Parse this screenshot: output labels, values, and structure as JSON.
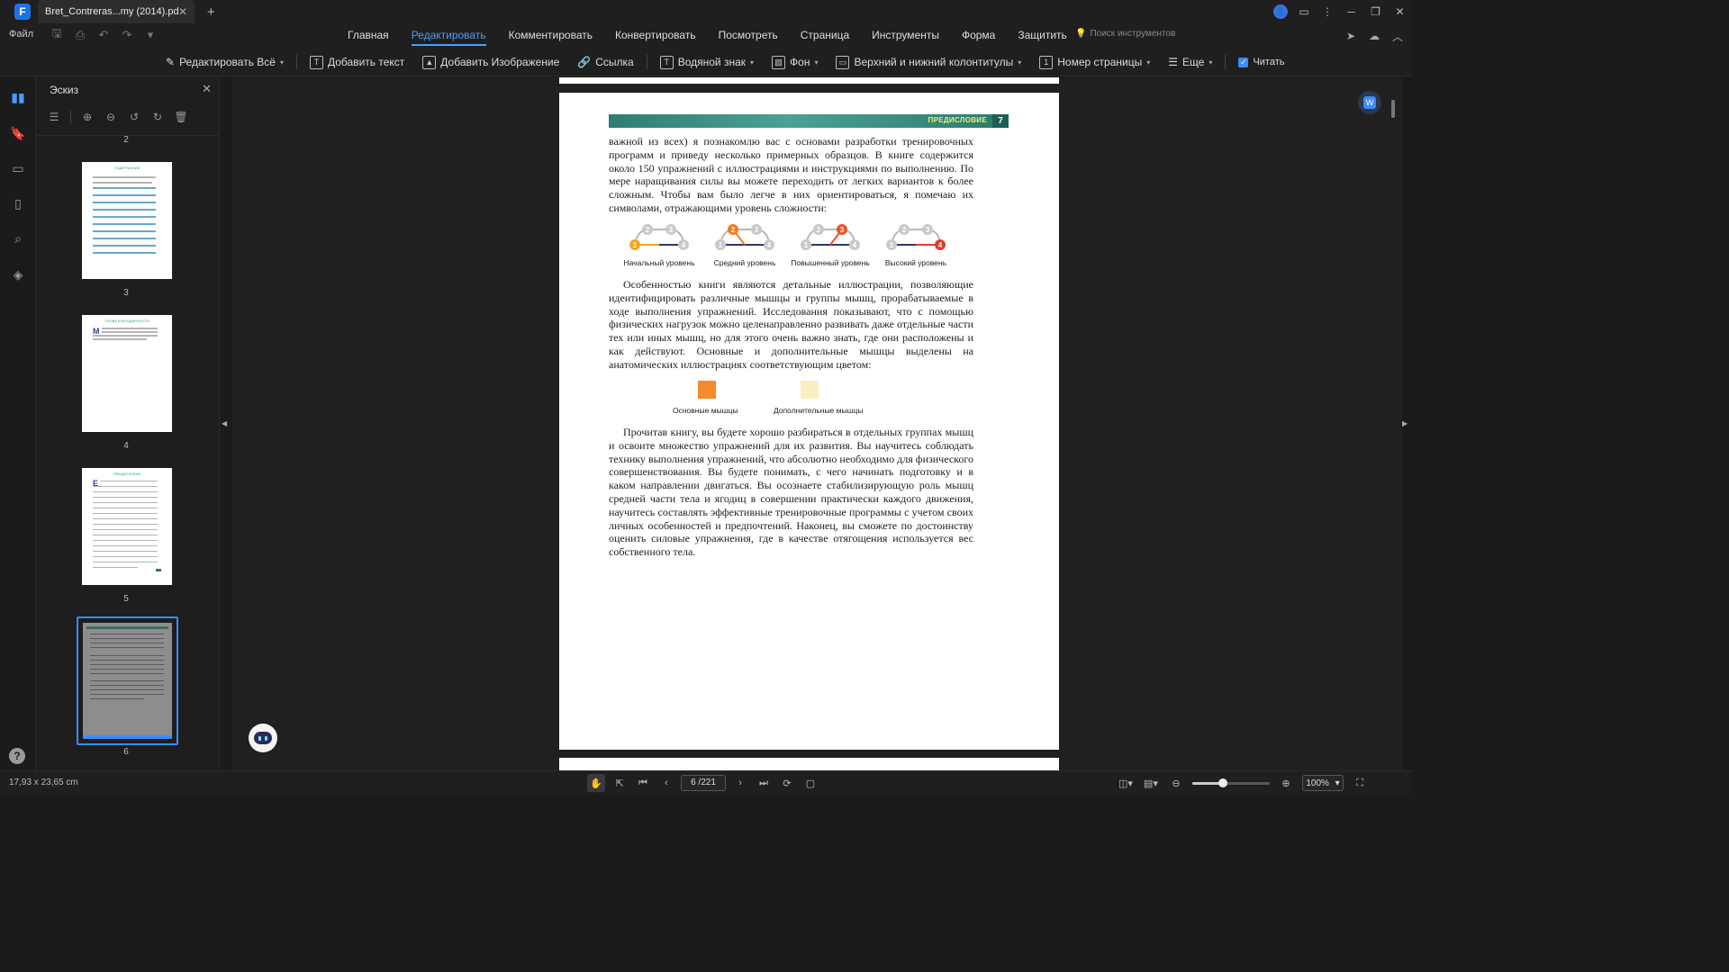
{
  "titlebar": {
    "app_logo": "F",
    "tab_title": "Bret_Contreras...my (2014).pdf",
    "tab_close_icon": "close-icon",
    "new_tab": "+"
  },
  "menu": {
    "file": "Файл",
    "items": [
      "Главная",
      "Редактировать",
      "Комментировать",
      "Конвертировать",
      "Посмотреть",
      "Страница",
      "Инструменты",
      "Форма",
      "Защитить"
    ],
    "active_item": "Редактировать",
    "tool_search": "Поиск инструментов"
  },
  "toolbar": {
    "edit_all": "Редактировать Всё",
    "add_text": "Добавить текст",
    "add_image": "Добавить Изображение",
    "link": "Ссылка",
    "watermark": "Водяной знак",
    "background": "Фон",
    "header_footer": "Верхний и нижний колонтитулы",
    "page_number": "Номер страницы",
    "more": "Еще",
    "read": "Читать",
    "read_checked": true
  },
  "thumbnails": {
    "title": "Эскиз",
    "pages": [
      {
        "label": "2"
      },
      {
        "label": "3",
        "heading": "СОДЕРЖАНИЕ"
      },
      {
        "label": "4",
        "heading": "СЛОВА БЛАГОДАРНОСТИ"
      },
      {
        "label": "5",
        "heading": "ПРЕДИСЛОВИЕ"
      },
      {
        "label": "6"
      }
    ],
    "selected": "6"
  },
  "document": {
    "header_section": "ПРЕДИСЛОВИЕ",
    "header_page": "7",
    "paragraph1": "важной из всех) я познакомлю вас с основами разработки тренировочных программ и приведу несколько примерных образцов. В книге содержится около 150 упражнений с иллюстрациями и инструкциями по выполнению. По мере наращивания силы вы можете переходить от легких вариантов к более сложным. Чтобы вам было легче в них ориентироваться, я помечаю их символами, отражающими уровень сложности:",
    "levels": [
      {
        "label": "Начальный уровень",
        "highlight": "1"
      },
      {
        "label": "Средний уровень",
        "highlight": "2"
      },
      {
        "label": "Повышенный уровень",
        "highlight": "3"
      },
      {
        "label": "Высокий уровень",
        "highlight": "4"
      }
    ],
    "level_numbers": [
      "1",
      "2",
      "3",
      "4"
    ],
    "paragraph2": "Особенностью книги являются детальные иллюстрации, позволяющие идентифицировать различные мышцы и группы мышц, прорабатываемые в ходе выполнения упражнений. Исследования показывают, что с помощью физических нагрузок можно целенаправленно развивать даже отдельные части тех или иных мышц, но для этого очень важно знать, где они расположены и как действуют. Основные и дополнительные мышцы выделены на анатомических иллюстрациях соответствующим цветом:",
    "muscle_primary": "Основные мышцы",
    "muscle_secondary": "Дополнительные мышцы",
    "paragraph3": "Прочитав книгу, вы будете хорошо разбираться в отдельных группах мышц и освоите множество упражнений для их развития. Вы научитесь соблюдать технику выполнения упражнений, что абсолютно необходимо для физического совершенствования. Вы будете понимать, с чего начинать подготовку и в каком направлении двигаться. Вы осознаете стабилизирующую роль мышц средней части тела и ягодиц в совершении практически каждого движения, научитесь составлять эффективные тренировочные программы с учетом своих личных особенностей и предпочтений. Наконец, вы сможете по достоинству оценить силовые упражнения, где в качестве отягощения используется вес собственного тела."
  },
  "colors": {
    "accent": "#3d8bff",
    "primary_muscle": "#f58a2a",
    "secondary_muscle": "#fbeec2",
    "level_highlight_1": "#f5a623",
    "level_highlight_2": "#f07a20",
    "level_highlight_3": "#e8552a",
    "level_highlight_4": "#e53b2a",
    "header_band": "#3a9084"
  },
  "statusbar": {
    "page_size": "17,93 x 23,65 cm",
    "page_input": "6 /221",
    "zoom_value": "100%",
    "zoom_level": 0.4
  }
}
